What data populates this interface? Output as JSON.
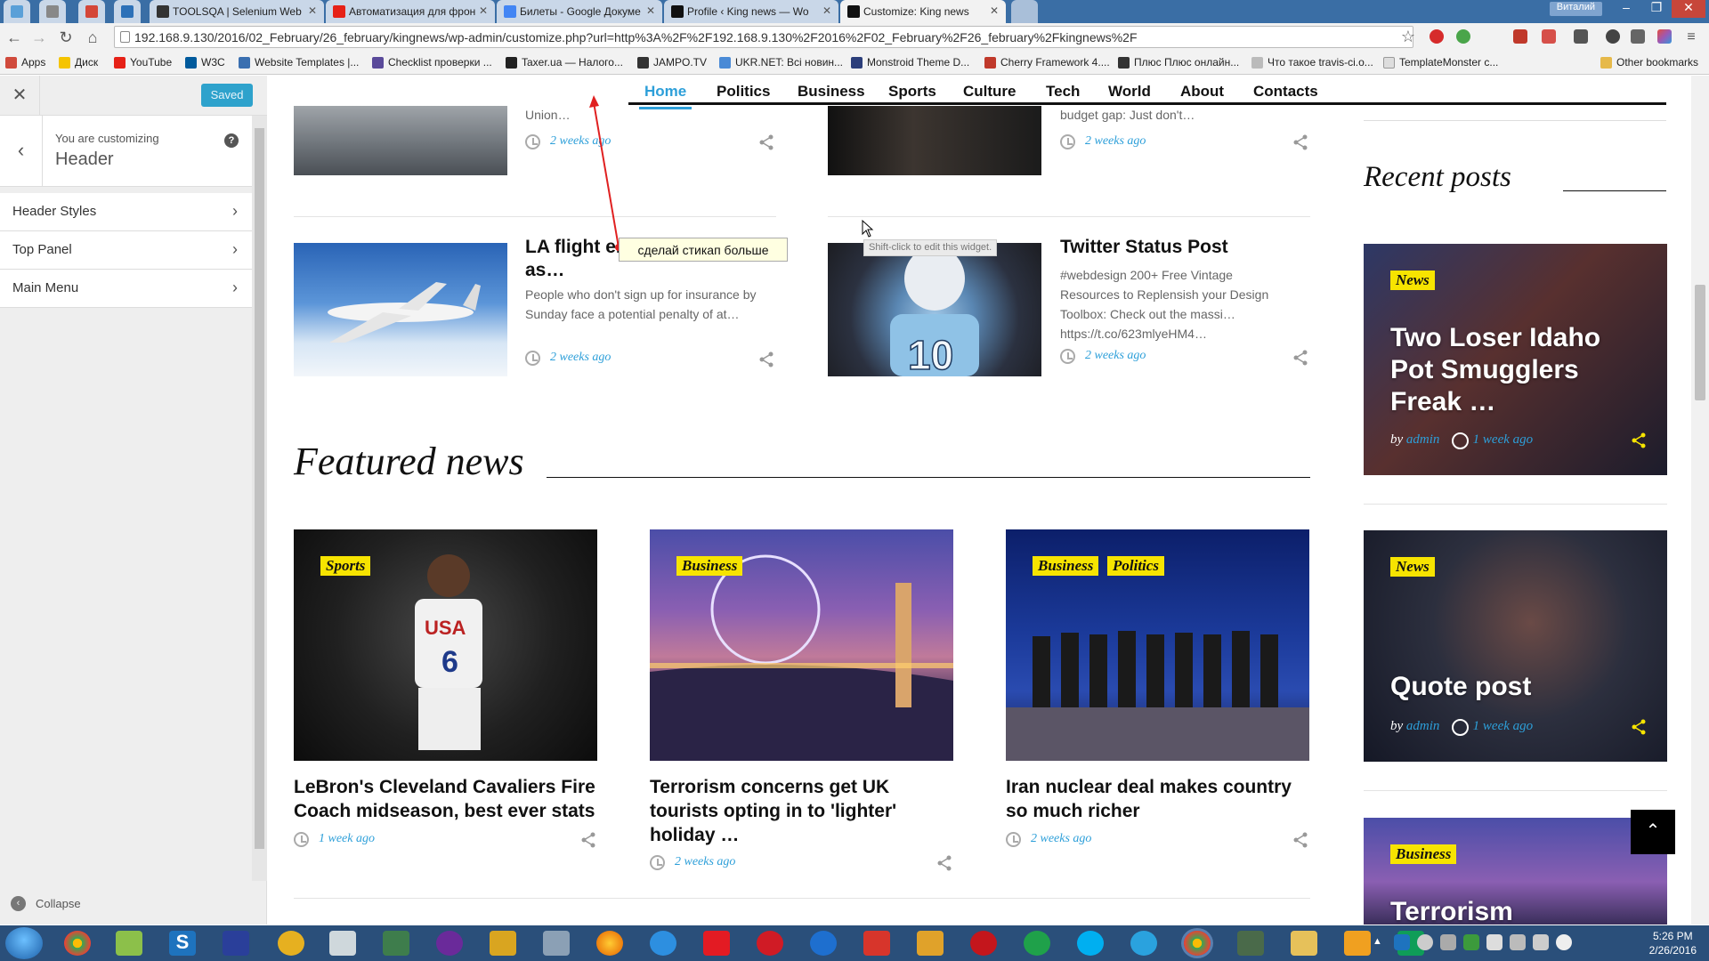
{
  "browser": {
    "tabs": [
      {
        "label": "",
        "color": "#5aa0d8"
      },
      {
        "label": "",
        "color": "#888888"
      },
      {
        "label": "",
        "color": "#d44638"
      },
      {
        "label": "",
        "color": "#2d71b8"
      },
      {
        "label": "TOOLSQA | Selenium Web",
        "color": "#333333"
      },
      {
        "label": "Автоматизация для фрон",
        "color": "#e62117"
      },
      {
        "label": "Билеты - Google Докуме",
        "color": "#4285f4"
      },
      {
        "label": "Profile ‹ King news — Wo",
        "color": "#111111"
      },
      {
        "label": "Customize: King news",
        "color": "#111111"
      }
    ],
    "user_chip": "Виталий",
    "url": "192.168.9.130/2016/02_February/26_february/kingnews/wp-admin/customize.php?url=http%3A%2F%2F192.168.9.130%2F2016%2F02_February%2F26_february%2Fkingnews%2F",
    "bookmarks": [
      "Apps",
      "Диск",
      "YouTube",
      "W3C",
      "Website Templates |...",
      "Checklist проверки ...",
      "Taxer.ua — Налого...",
      "JAMPO.TV",
      "UKR.NET: Всі новин...",
      "Monstroid Theme D...",
      "Cherry Framework 4....",
      "Плюс Плюс онлайн...",
      "Что такое travis-ci.o...",
      "TemplateMonster c...",
      "Other bookmarks"
    ]
  },
  "customizer": {
    "saved_label": "Saved",
    "you_are": "You are customizing",
    "section_title": "Header",
    "sections": [
      "Header Styles",
      "Top Panel",
      "Main Menu"
    ],
    "collapse_label": "Collapse"
  },
  "site": {
    "nav": [
      "Home",
      "Politics",
      "Business",
      "Sports",
      "Culture",
      "Tech",
      "World",
      "About",
      "Contacts"
    ],
    "top_articles": [
      {
        "excerpt": "Union…",
        "date": "2 weeks ago"
      },
      {
        "excerpt": "budget gap: Just don't…",
        "date": "2 weeks ago"
      },
      {
        "title": "LA flight emergently lands as…",
        "excerpt": "People who don't sign up for insurance by Sunday face a potential penalty of at…",
        "date": "2 weeks ago"
      },
      {
        "title": "Twitter Status Post",
        "excerpt": "#webdesign 200+ Free Vintage Resources to Replensish your Design Toolbox: Check out the massi… https://t.co/623mlyeHM4…",
        "date": "2 weeks ago"
      }
    ],
    "featured_title": "Featured news",
    "featured": [
      {
        "tags": [
          "Sports"
        ],
        "title": "LeBron's Cleveland Cavaliers Fire Coach midseason, best ever stats",
        "date": "1 week ago"
      },
      {
        "tags": [
          "Business"
        ],
        "title": "Terrorism concerns get UK tourists opting in to 'lighter' holiday …",
        "date": "2 weeks ago"
      },
      {
        "tags": [
          "Business",
          "Politics"
        ],
        "title": "Iran nuclear deal makes country so much richer",
        "date": "2 weeks ago"
      }
    ],
    "recent_title": "Recent posts",
    "recent": [
      {
        "tag": "News",
        "title": "Two Loser Idaho Pot Smugglers Freak …",
        "by": "by",
        "author": "admin",
        "date": "1 week ago"
      },
      {
        "tag": "News",
        "title": "Quote post",
        "by": "by",
        "author": "admin",
        "date": "1 week ago"
      },
      {
        "tag": "Business",
        "title": "Terrorism"
      }
    ],
    "annotation": "сделай стикап больше",
    "widget_tip": "Shift-click to edit this widget."
  },
  "taskbar": {
    "time": "5:26 PM",
    "date": "2/26/2016"
  },
  "colors": {
    "accent": "#2d9fd9",
    "tag": "#f7e400",
    "saved": "#2ea2cc"
  }
}
